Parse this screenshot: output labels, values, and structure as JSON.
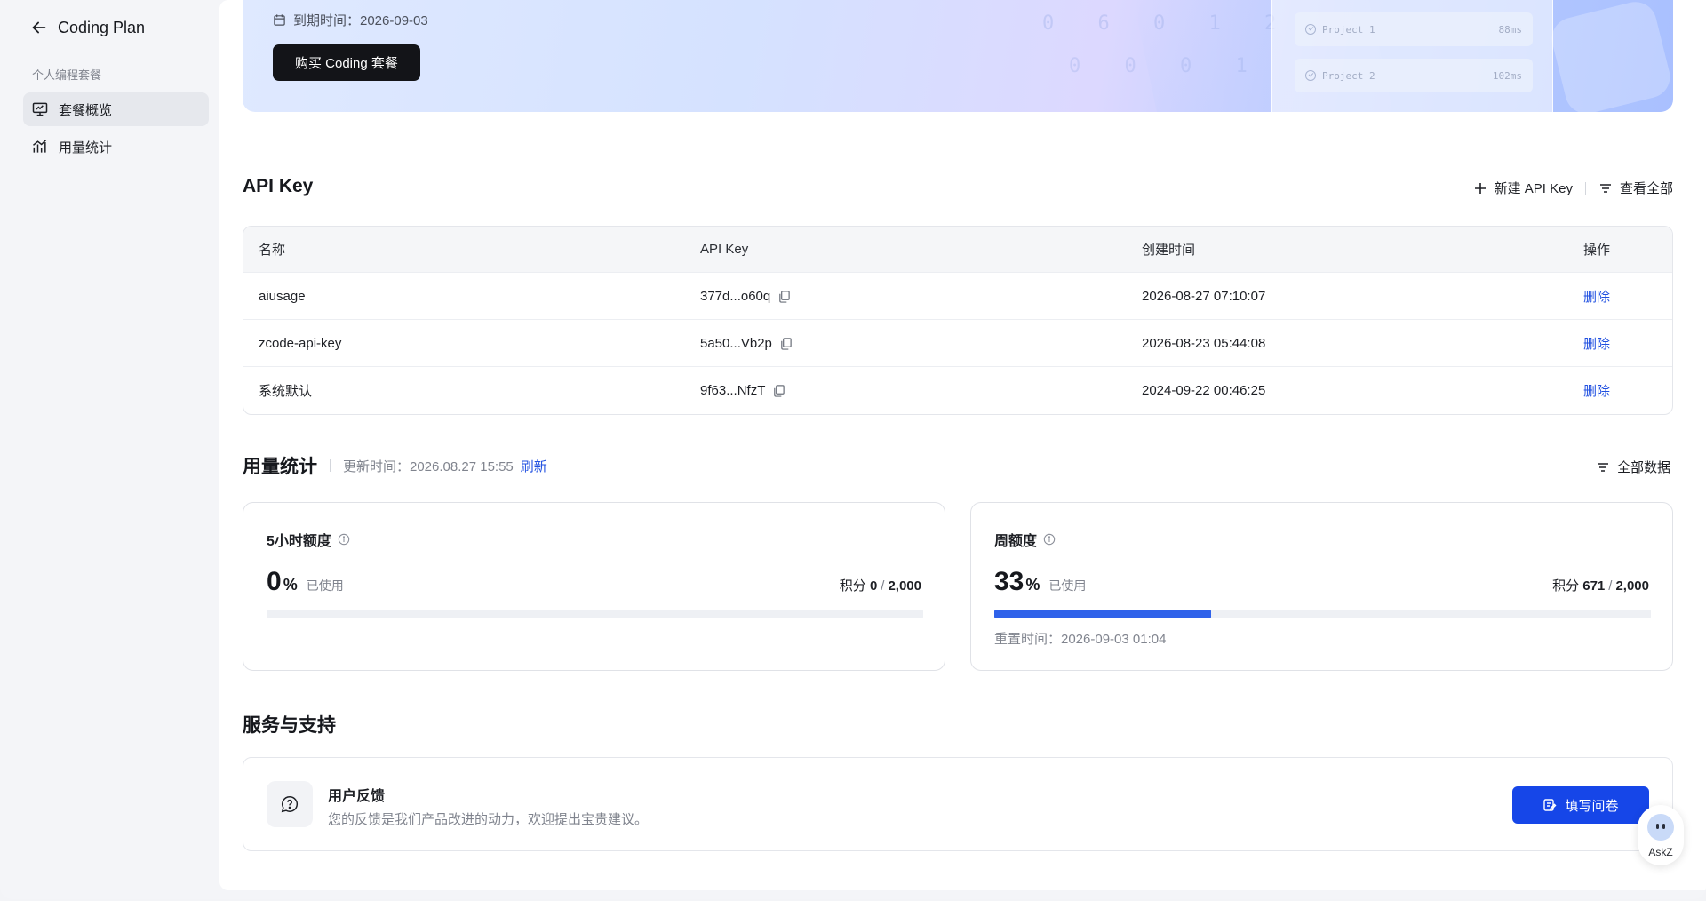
{
  "sidebar": {
    "title": "Coding Plan",
    "section": "个人编程套餐",
    "items": [
      {
        "label": "套餐概览",
        "icon": "monitor-icon",
        "active": true
      },
      {
        "label": "用量统计",
        "icon": "bar-chart-icon",
        "active": false
      }
    ]
  },
  "banner": {
    "expire_label": "到期时间：2026-09-03",
    "buy_button": "购买 Coding 套餐",
    "projects": [
      {
        "name": "Project 1",
        "ms": "88ms"
      },
      {
        "name": "Project 2",
        "ms": "102ms"
      }
    ]
  },
  "api": {
    "title": "API Key",
    "new_label": "新建 API Key",
    "view_all_label": "查看全部",
    "columns": [
      "名称",
      "API Key",
      "创建时间",
      "操作"
    ],
    "rows": [
      {
        "name": "aiusage",
        "key": "377d...o60q",
        "created": "2026-08-27 07:10:07",
        "action": "删除"
      },
      {
        "name": "zcode-api-key",
        "key": "5a50...Vb2p",
        "created": "2026-08-23 05:44:08",
        "action": "删除"
      },
      {
        "name": "系统默认",
        "key": "9f63...NfzT",
        "created": "2024-09-22 00:46:25",
        "action": "删除"
      }
    ]
  },
  "usage": {
    "title": "用量统计",
    "updated": "更新时间：2026.08.27 15:55",
    "refresh": "刷新",
    "all_data": "全部数据",
    "cards": [
      {
        "title": "5小时额度",
        "percent": "0",
        "percent_value": 0,
        "pct_sign": "%",
        "used_label": "已使用",
        "points_label": "积分",
        "points_used": "0",
        "points_total": "2,000",
        "reset": ""
      },
      {
        "title": "周额度",
        "percent": "33",
        "percent_value": 33,
        "pct_sign": "%",
        "used_label": "已使用",
        "points_label": "积分",
        "points_used": "671",
        "points_total": "2,000",
        "reset": "重置时间：2026-09-03 01:04"
      }
    ]
  },
  "support": {
    "title": "服务与支持",
    "card_title": "用户反馈",
    "card_desc": "您的反馈是我们产品改进的动力，欢迎提出宝贵建议。",
    "button": "填写问卷"
  },
  "askz": {
    "label": "AskZ"
  },
  "colors": {
    "accent": "#1646e8",
    "progress": "#2f62ea",
    "link": "#1f4fe0"
  }
}
